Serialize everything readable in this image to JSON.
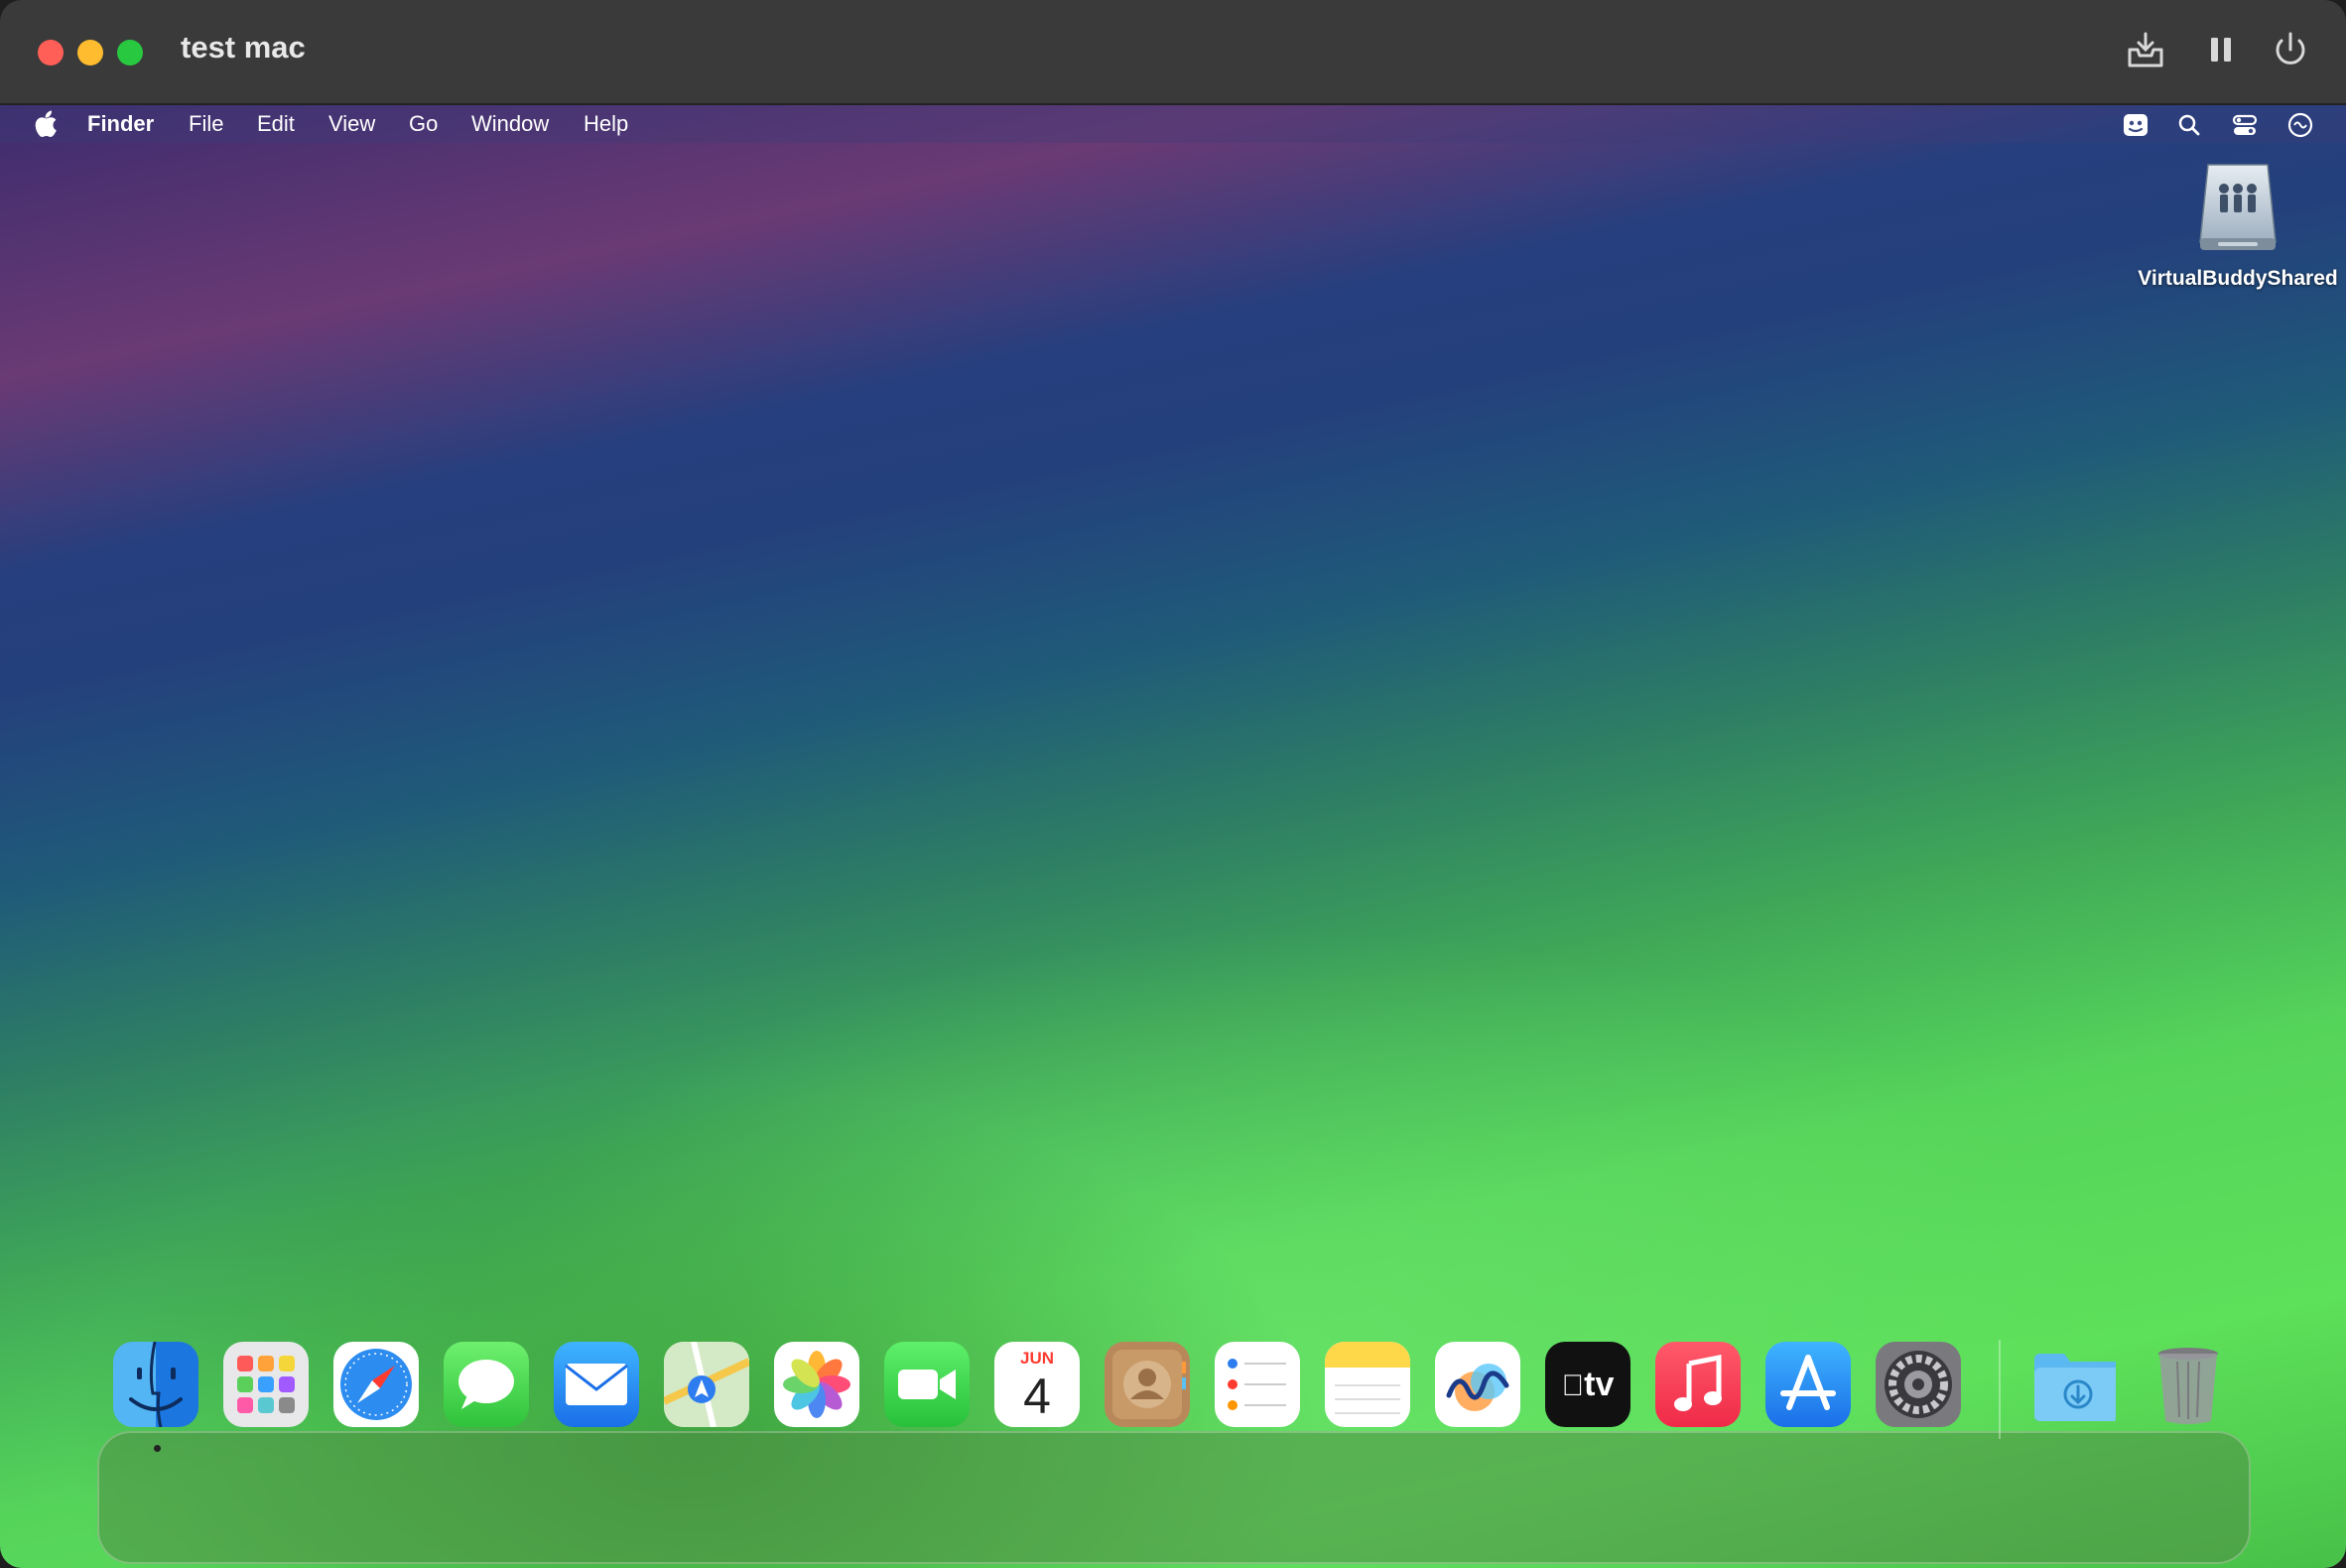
{
  "window": {
    "title": "test mac"
  },
  "titlebar_icons": [
    "tray-download-icon",
    "pause-icon",
    "power-icon"
  ],
  "menubar": {
    "apple": "apple-logo-icon",
    "app_name": "Finder",
    "items": [
      "File",
      "Edit",
      "View",
      "Go",
      "Window",
      "Help"
    ],
    "status_icons": [
      "virtualbuddy-icon",
      "search-icon",
      "control-center-icon",
      "siri-icon"
    ]
  },
  "desktop": {
    "items": [
      {
        "label": "VirtualBuddyShared",
        "icon": "shared-drive-icon"
      }
    ]
  },
  "dock": {
    "apps": [
      "Finder",
      "Launchpad",
      "Safari",
      "Messages",
      "Mail",
      "Maps",
      "Photos",
      "FaceTime",
      "Calendar",
      "Contacts",
      "Reminders",
      "Notes",
      "Freeform",
      "TV",
      "Music",
      "App Store",
      "System Settings",
      "Downloads",
      "Trash"
    ],
    "calendar": {
      "month": "JUN",
      "day": "4"
    },
    "tv_label": "tv"
  },
  "colors": {
    "close": "#ff5f57",
    "minimize": "#febc2e",
    "maximize": "#28c840",
    "titlebar": "#3a3a3a"
  }
}
